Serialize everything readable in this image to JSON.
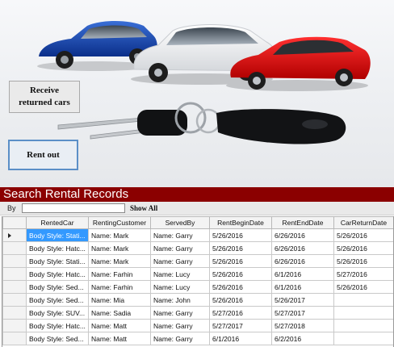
{
  "actions": {
    "receive_label": "Receive\nreturned cars",
    "rent_label": "Rent out"
  },
  "search": {
    "title": "Search Rental Records",
    "by_label": "By",
    "by_value": "",
    "show_all_label": "Show All"
  },
  "grid": {
    "columns": [
      "RentedCar",
      "RentingCustomer",
      "ServedBy",
      "RentBeginDate",
      "RentEndDate",
      "CarReturnDate"
    ],
    "rows": [
      [
        "Body Style: Stati...",
        "Name: Mark",
        "Name: Garry",
        "5/26/2016",
        "6/26/2016",
        "5/26/2016"
      ],
      [
        "Body Style: Hatc...",
        "Name: Mark",
        "Name: Garry",
        "5/26/2016",
        "6/26/2016",
        "5/26/2016"
      ],
      [
        "Body Style: Stati...",
        "Name: Mark",
        "Name: Garry",
        "5/26/2016",
        "6/26/2016",
        "5/26/2016"
      ],
      [
        "Body Style: Hatc...",
        "Name: Farhin",
        "Name: Lucy",
        "5/26/2016",
        "6/1/2016",
        "5/27/2016"
      ],
      [
        "Body Style: Sed...",
        "Name: Farhin",
        "Name: Lucy",
        "5/26/2016",
        "6/1/2016",
        "5/26/2016"
      ],
      [
        "Body Style: Sed...",
        "Name: Mia",
        "Name: John",
        "5/26/2016",
        "5/26/2017",
        ""
      ],
      [
        "Body Style: SUV...",
        "Name: Sadia",
        "Name: Garry",
        "5/27/2016",
        "5/27/2017",
        ""
      ],
      [
        "Body Style: Hatc...",
        "Name: Matt",
        "Name: Garry",
        "5/27/2017",
        "5/27/2018",
        ""
      ],
      [
        "Body Style: Sed...",
        "Name: Matt",
        "Name: Garry",
        "6/1/2016",
        "6/2/2016",
        ""
      ]
    ],
    "selection_color": "#3399ff"
  },
  "colors": {
    "header_bar": "#8b0000"
  }
}
